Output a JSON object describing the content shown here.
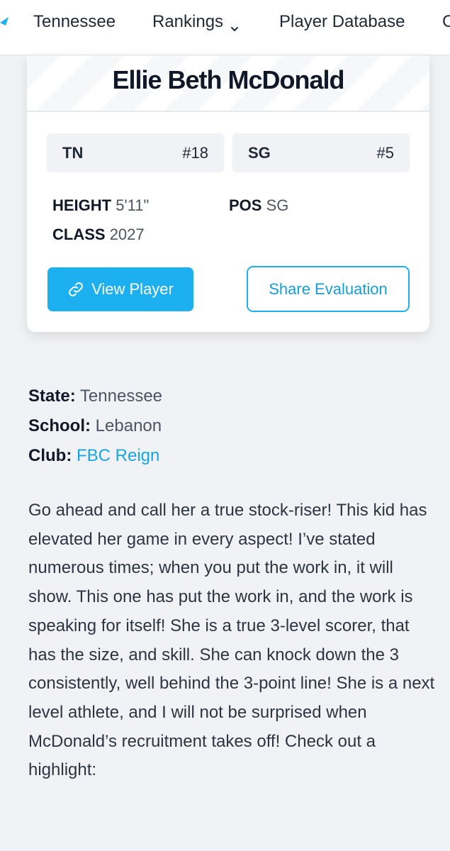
{
  "nav": {
    "logo_icon": "logo-mark-icon",
    "items": [
      {
        "label": "Tennessee"
      },
      {
        "label": "Rankings",
        "icon": "chevron-down-icon"
      },
      {
        "label": "Player Database"
      },
      {
        "label": "C"
      }
    ]
  },
  "player": {
    "name": "Ellie Beth McDonald",
    "state_rank": {
      "label": "TN",
      "value": "#18"
    },
    "position_rank": {
      "label": "SG",
      "value": "#5"
    },
    "height": {
      "label": "HEIGHT",
      "value": "5'11\""
    },
    "pos": {
      "label": "POS",
      "value": "SG"
    },
    "class": {
      "label": "CLASS",
      "value": "2027"
    },
    "view_button": {
      "label": "View Player",
      "icon": "link-icon"
    },
    "share_button": {
      "label": "Share Evaluation"
    }
  },
  "details": {
    "state": {
      "label": "State:",
      "value": "Tennessee"
    },
    "school": {
      "label": "School:",
      "value": "Lebanon"
    },
    "club": {
      "label": "Club:",
      "value": "FBC Reign"
    }
  },
  "evaluation": "Go ahead and call her a true stock-riser! This kid has elevated her game in every aspect! I’ve stated numerous times; when you put the work in, it will show. This one has put the work in, and the work is speaking for itself! She is a true 3-level scorer, that has the size, and skill. She can knock down the 3 consistently, well behind the 3-point line! She is a next level athlete, and I will not be surprised when McDonald’s recruitment takes off! Check out a highlight:",
  "colors": {
    "accent": "#1cb0f0",
    "link": "#16a6e6",
    "background": "#f1f2f5"
  }
}
